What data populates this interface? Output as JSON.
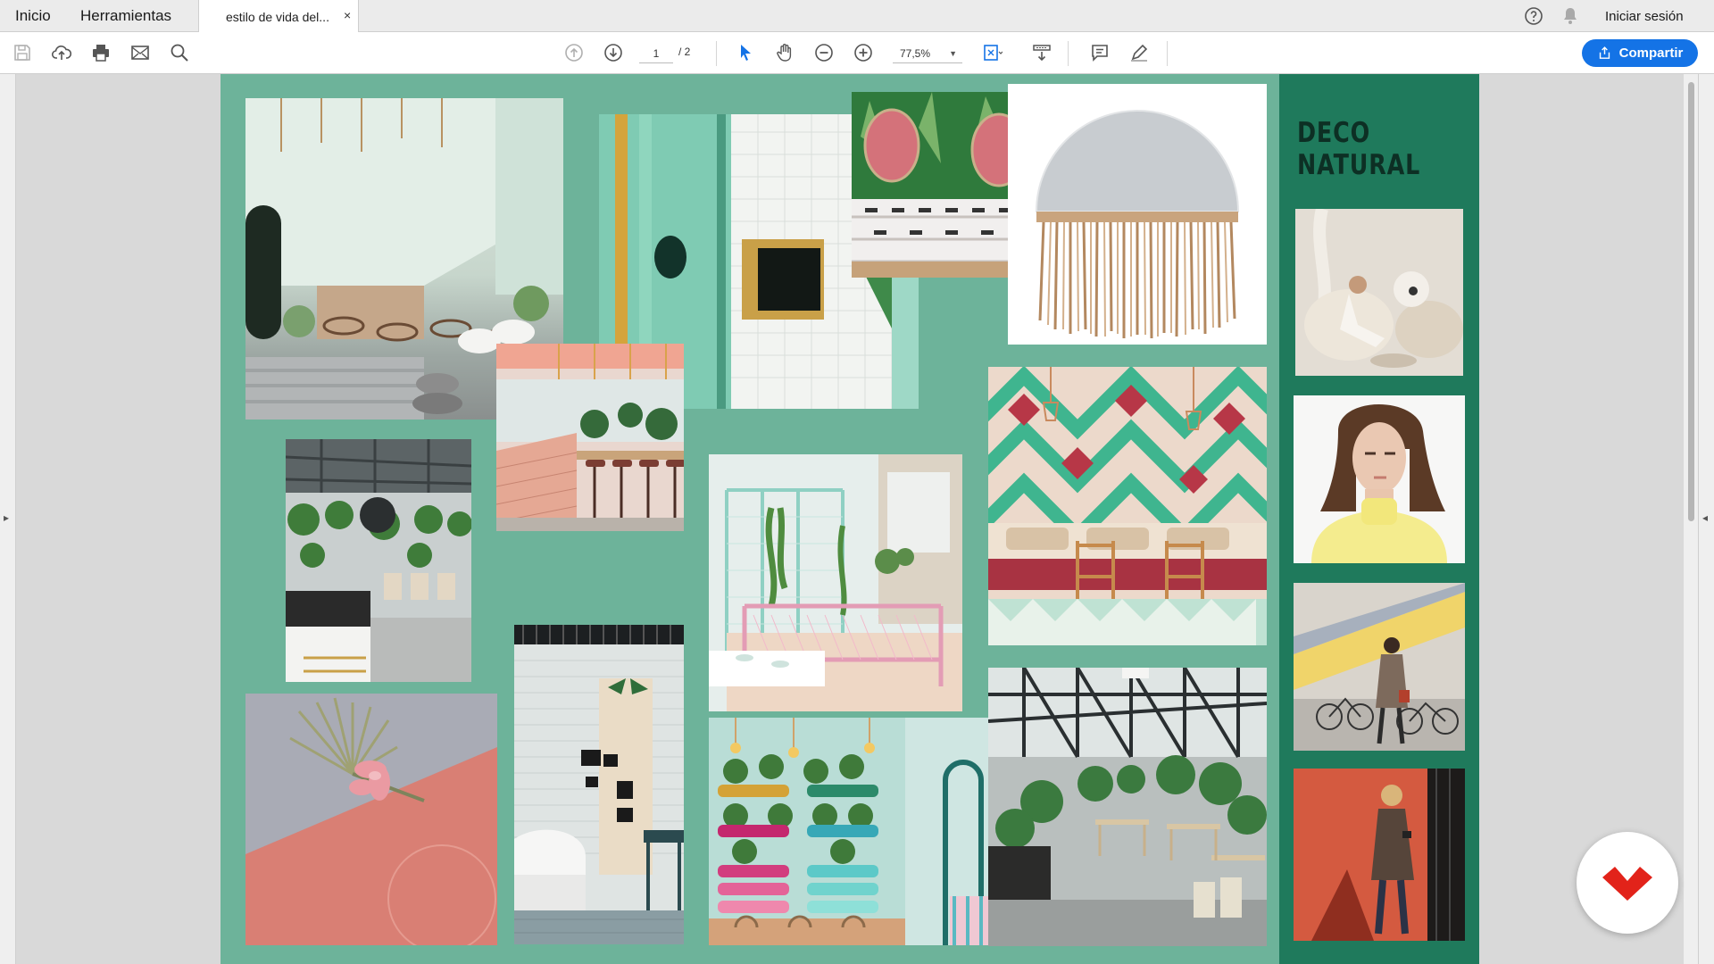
{
  "tabs": {
    "home": "Inicio",
    "tools": "Herramientas",
    "document": "estilo de vida del...",
    "close": "×"
  },
  "account": {
    "sign_in": "Iniciar sesión"
  },
  "toolbar": {
    "page_current": "1",
    "page_total": "/ 2",
    "zoom": "77,5%",
    "share_label": "Compartir"
  },
  "document": {
    "heading_line1": "DECO",
    "heading_line2": "NATURAL"
  },
  "colors": {
    "page_bg": "#6db39a",
    "side_panel": "#1f7a5c",
    "accent_blue": "#1473e6",
    "brand_red": "#e2231a"
  },
  "icons": [
    "save-icon",
    "upload-icon",
    "print-icon",
    "email-icon",
    "search-icon",
    "page-up-icon",
    "page-down-icon",
    "select-cursor-icon",
    "hand-icon",
    "zoom-out-icon",
    "zoom-in-icon",
    "fit-page-icon",
    "scroll-mode-icon",
    "comment-icon",
    "highlight-pen-icon",
    "help-icon",
    "notification-bell-icon",
    "share-icon",
    "brand-logo-icon"
  ]
}
